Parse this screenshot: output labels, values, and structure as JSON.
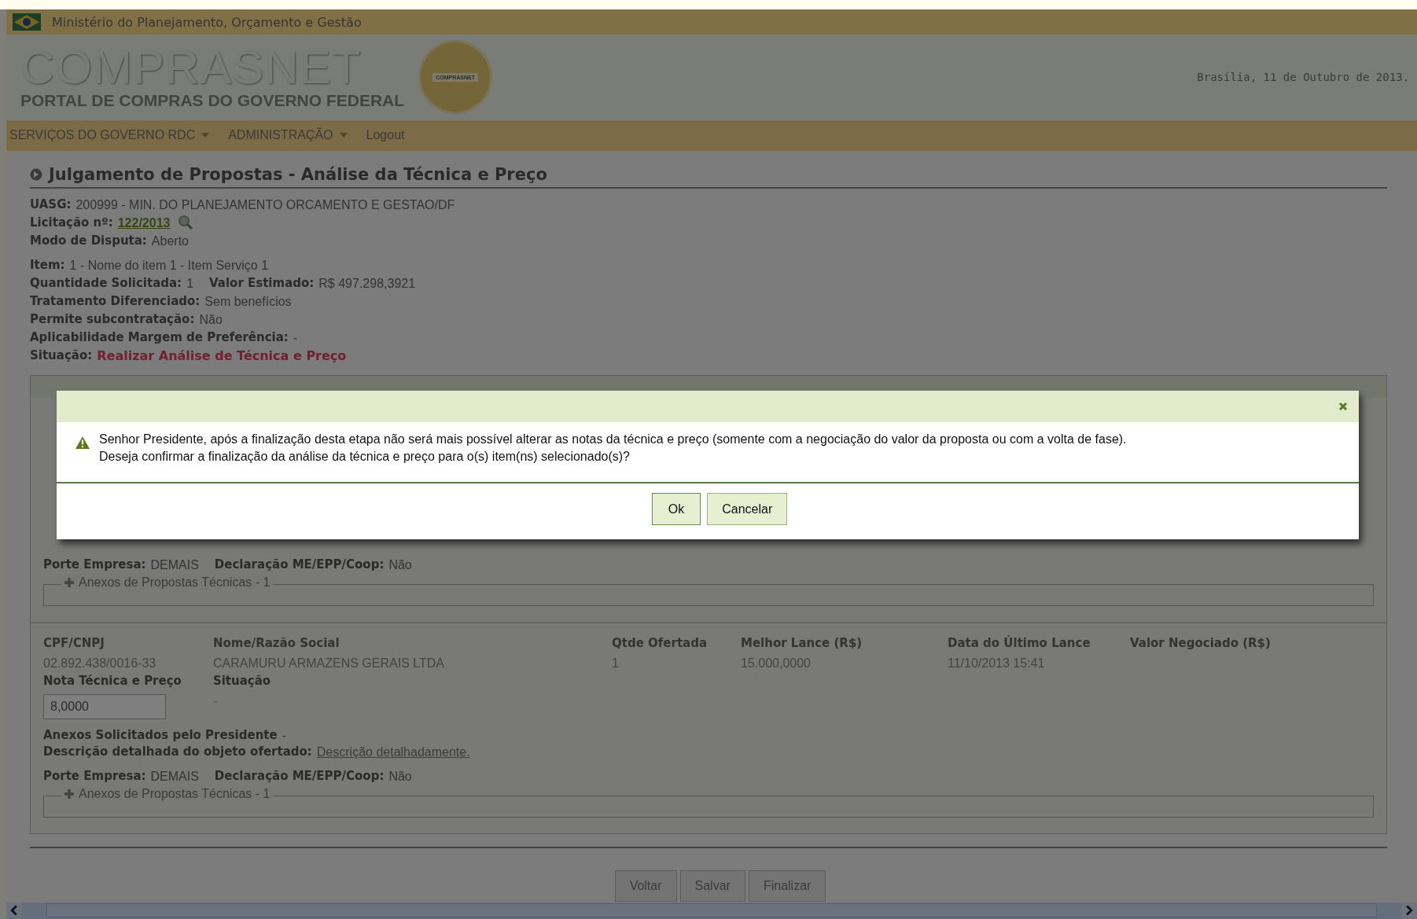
{
  "top_bar": {
    "ministry": "Ministério do Planejamento, Orçamento e Gestão"
  },
  "header": {
    "logo_title": "COMPRASNET",
    "logo_subtitle": "PORTAL DE COMPRAS DO GOVERNO FEDERAL",
    "seal_text": "COMPRASNET",
    "date": "Brasília, 11 de Outubro de 2013."
  },
  "nav": [
    {
      "label": "SERVIÇOS DO GOVERNO RDC",
      "dropdown": true
    },
    {
      "label": "ADMINISTRAÇÃO",
      "dropdown": true
    },
    {
      "label": "Logout",
      "dropdown": false
    }
  ],
  "page_title": "Julgamento de Propostas - Análise da Técnica e Preço",
  "info_groups": [
    [
      [
        {
          "label": "UASG:",
          "value": "200999 - MIN. DO PLANEJAMENTO ORCAMENTO E GESTAO/DF",
          "kind": "plain"
        }
      ],
      [
        {
          "label": "Licitação nº:",
          "value": "122/2013",
          "kind": "link"
        }
      ],
      [
        {
          "label": "Modo de Disputa:",
          "value": "Aberto",
          "kind": "plain"
        }
      ]
    ],
    [
      [
        {
          "label": "Item:",
          "value": "1 - Nome do item 1 - Item Serviço 1",
          "kind": "plain"
        }
      ],
      [
        {
          "label": "Quantidade Solicitada:",
          "value": "1",
          "kind": "plain"
        },
        {
          "label": "Valor Estimado:",
          "value": "R$ 497.298,3921",
          "kind": "plain"
        }
      ],
      [
        {
          "label": "Tratamento Diferenciado:",
          "value": "Sem benefícios",
          "kind": "plain"
        }
      ],
      [
        {
          "label": "Permite subcontratação:",
          "value": "Não",
          "kind": "plain"
        }
      ],
      [
        {
          "label": "Aplicabilidade Margem de Preferência:",
          "value": "-",
          "kind": "plain"
        }
      ],
      [
        {
          "label": "Situação:",
          "value": "Realizar Análise de Técnica e Preço",
          "kind": "alert"
        }
      ]
    ]
  ],
  "proposals": [
    {
      "details": [
        [
          {
            "label": "Porte Empresa:",
            "value": "DEMAIS"
          },
          {
            "label": "Declaração ME/EPP/Coop:",
            "value": "Não"
          }
        ]
      ],
      "attachments_legend": "Anexos de Propostas Técnicas - 1"
    },
    {
      "columns": [
        "CPF/CNPJ",
        "Nome/Razão Social",
        "Qtde Ofertada",
        "Melhor Lance (R$)",
        "Data do Último Lance",
        "Valor Negociado (R$)"
      ],
      "values": [
        "02.892.438/0016-33",
        "CARAMURU ARMAZENS GERAIS LTDA",
        "1",
        "15.000,0000",
        "11/10/2013 15:41"
      ],
      "score_label": "Nota Técnica e Preço",
      "status_label": "Situação",
      "score_value": "8,0000",
      "status_value": "-",
      "requested_label": "Anexos Solicitados pelo Presidente",
      "requested_value": "-",
      "description_label": "Descrição detalhada do objeto ofertado:",
      "description_link": "Descrição detalhadamente.",
      "details": [
        [
          {
            "label": "Porte Empresa:",
            "value": "DEMAIS"
          },
          {
            "label": "Declaração ME/EPP/Coop:",
            "value": "Não"
          }
        ]
      ],
      "attachments_legend": "Anexos de Propostas Técnicas - 1"
    }
  ],
  "footer_buttons": [
    "Voltar",
    "Salvar",
    "Finalizar"
  ],
  "dialog": {
    "message_lines": [
      "Senhor Presidente, após a finalização desta etapa não será mais possível alterar as notas da técnica e preço (somente com a negociação do valor da proposta ou com a volta de fase).",
      "Deseja confirmar a finalização da análise da técnica e preço para o(s) item(ns) selecionado(s)?"
    ],
    "buttons": [
      {
        "label": "Ok",
        "kind": "primary"
      },
      {
        "label": "Cancelar",
        "kind": "secondary"
      }
    ]
  }
}
